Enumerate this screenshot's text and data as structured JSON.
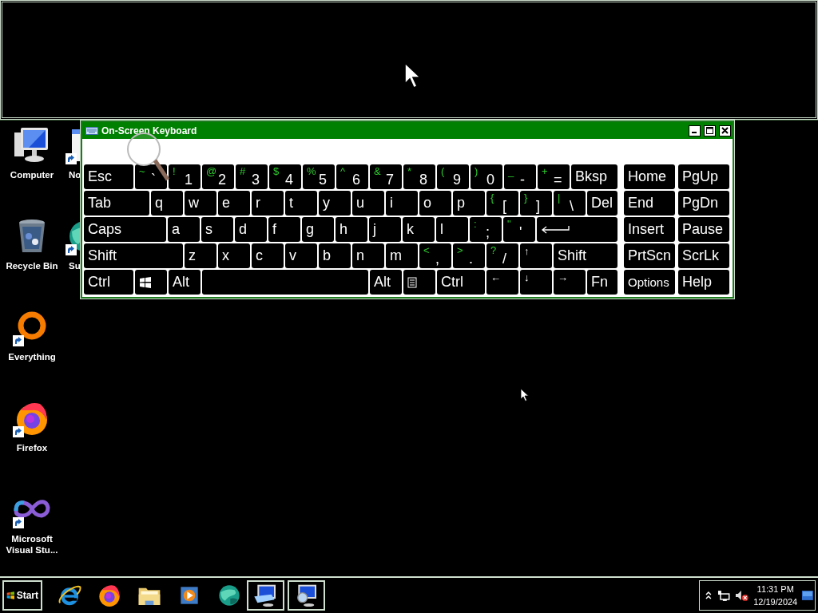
{
  "desktop_icons": [
    {
      "label": "Computer",
      "kind": "computer",
      "shortcut": false
    },
    {
      "label": "Recycle Bin",
      "kind": "recycle",
      "shortcut": false
    },
    {
      "label": "Everything",
      "kind": "everything",
      "shortcut": true
    },
    {
      "label": "Firefox",
      "kind": "firefox",
      "shortcut": true
    },
    {
      "label": "Microsoft Visual Stu...",
      "kind": "vs",
      "shortcut": true
    }
  ],
  "desktop_icons_column_2": [
    {
      "label": "No",
      "kind": "notepad",
      "shortcut": true
    },
    {
      "label": "Su",
      "kind": "globe",
      "shortcut": true
    }
  ],
  "keyboard_window": {
    "title": "On-Screen Keyboard",
    "rows": [
      {
        "keys": [
          {
            "kind": "text",
            "label": "Esc"
          },
          {
            "kind": "dual",
            "shift": "~",
            "label": "`"
          },
          {
            "kind": "dual",
            "shift": "!",
            "label": "1"
          },
          {
            "kind": "dual",
            "shift": "@",
            "label": "2"
          },
          {
            "kind": "dual",
            "shift": "#",
            "label": "3"
          },
          {
            "kind": "dual",
            "shift": "$",
            "label": "4"
          },
          {
            "kind": "dual",
            "shift": "%",
            "label": "5"
          },
          {
            "kind": "dual",
            "shift": "^",
            "label": "6"
          },
          {
            "kind": "dual",
            "shift": "&",
            "label": "7"
          },
          {
            "kind": "dual",
            "shift": "*",
            "label": "8"
          },
          {
            "kind": "dual",
            "shift": "(",
            "label": "9"
          },
          {
            "kind": "dual",
            "shift": ")",
            "label": "0"
          },
          {
            "kind": "dual",
            "shift": "_",
            "label": "-"
          },
          {
            "kind": "dual",
            "shift": "+",
            "label": "="
          },
          {
            "kind": "text",
            "label": "Bksp"
          }
        ]
      },
      {
        "keys": [
          {
            "kind": "text",
            "label": "Tab"
          },
          {
            "kind": "text",
            "label": "q"
          },
          {
            "kind": "text",
            "label": "w"
          },
          {
            "kind": "text",
            "label": "e"
          },
          {
            "kind": "text",
            "label": "r"
          },
          {
            "kind": "text",
            "label": "t"
          },
          {
            "kind": "text",
            "label": "y"
          },
          {
            "kind": "text",
            "label": "u"
          },
          {
            "kind": "text",
            "label": "i"
          },
          {
            "kind": "text",
            "label": "o"
          },
          {
            "kind": "text",
            "label": "p"
          },
          {
            "kind": "dual",
            "shift": "{",
            "label": "["
          },
          {
            "kind": "dual",
            "shift": "}",
            "label": "]"
          },
          {
            "kind": "dual",
            "shift": "|",
            "label": "\\"
          },
          {
            "kind": "text",
            "label": "Del"
          }
        ]
      },
      {
        "keys": [
          {
            "kind": "text",
            "label": "Caps"
          },
          {
            "kind": "text",
            "label": "a"
          },
          {
            "kind": "text",
            "label": "s"
          },
          {
            "kind": "text",
            "label": "d"
          },
          {
            "kind": "text",
            "label": "f"
          },
          {
            "kind": "text",
            "label": "g"
          },
          {
            "kind": "text",
            "label": "h"
          },
          {
            "kind": "text",
            "label": "j"
          },
          {
            "kind": "text",
            "label": "k"
          },
          {
            "kind": "text",
            "label": "l"
          },
          {
            "kind": "dual",
            "shift": ":",
            "label": ";"
          },
          {
            "kind": "dual",
            "shift": "\"",
            "label": "'"
          },
          {
            "kind": "enter"
          }
        ]
      },
      {
        "keys": [
          {
            "kind": "text",
            "label": "Shift"
          },
          {
            "kind": "text",
            "label": "z"
          },
          {
            "kind": "text",
            "label": "x"
          },
          {
            "kind": "text",
            "label": "c"
          },
          {
            "kind": "text",
            "label": "v"
          },
          {
            "kind": "text",
            "label": "b"
          },
          {
            "kind": "text",
            "label": "n"
          },
          {
            "kind": "text",
            "label": "m"
          },
          {
            "kind": "dual",
            "shift": "<",
            "label": ","
          },
          {
            "kind": "dual",
            "shift": ">",
            "label": "."
          },
          {
            "kind": "dual",
            "shift": "?",
            "label": "/"
          },
          {
            "kind": "arrow",
            "label": "↑"
          },
          {
            "kind": "text",
            "label": "Shift"
          }
        ]
      },
      {
        "keys": [
          {
            "kind": "text",
            "label": "Ctrl"
          },
          {
            "kind": "windows"
          },
          {
            "kind": "text",
            "label": "Alt"
          },
          {
            "kind": "space"
          },
          {
            "kind": "text",
            "label": "Alt"
          },
          {
            "kind": "menu"
          },
          {
            "kind": "text",
            "label": "Ctrl"
          },
          {
            "kind": "arrow",
            "label": "←"
          },
          {
            "kind": "arrow",
            "label": "↓"
          },
          {
            "kind": "arrow",
            "label": "→"
          },
          {
            "kind": "text",
            "label": "Fn"
          }
        ]
      }
    ],
    "nav_rows": [
      {
        "keys": [
          {
            "kind": "text",
            "label": "Home"
          },
          {
            "kind": "text",
            "label": "PgUp"
          }
        ]
      },
      {
        "keys": [
          {
            "kind": "text",
            "label": "End"
          },
          {
            "kind": "text",
            "label": "PgDn"
          }
        ]
      },
      {
        "keys": [
          {
            "kind": "text",
            "label": "Insert"
          },
          {
            "kind": "text",
            "label": "Pause"
          }
        ]
      },
      {
        "keys": [
          {
            "kind": "text",
            "label": "PrtScn"
          },
          {
            "kind": "text",
            "label": "ScrLk"
          }
        ]
      },
      {
        "keys": [
          {
            "kind": "small",
            "label": "Options"
          },
          {
            "kind": "text",
            "label": "Help"
          }
        ]
      }
    ]
  },
  "taskbar": {
    "start": "Start",
    "apps": [
      {
        "kind": "ie",
        "active": false
      },
      {
        "kind": "firefox",
        "active": false
      },
      {
        "kind": "folder",
        "active": false
      },
      {
        "kind": "media",
        "active": false
      },
      {
        "kind": "globe",
        "active": false
      },
      {
        "kind": "keyboard",
        "active": true
      },
      {
        "kind": "magnifier",
        "active": true
      }
    ],
    "tray": {
      "time": "11:31 PM",
      "date": "12/19/2024"
    }
  }
}
